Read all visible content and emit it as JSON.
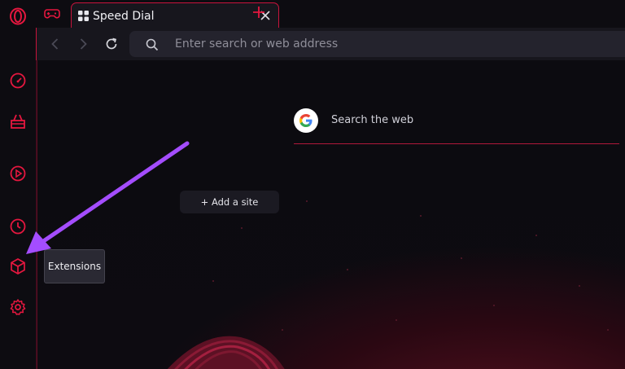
{
  "tab": {
    "title": "Speed Dial"
  },
  "address_bar": {
    "placeholder": "Enter search or web address"
  },
  "speed_dial": {
    "search_label": "Search the web",
    "add_site_label": "+ Add a site"
  },
  "tooltip": {
    "text": "Extensions"
  },
  "sidebar": {
    "items": [
      {
        "icon": "opera-logo-icon"
      },
      {
        "icon": "speedometer-icon"
      },
      {
        "icon": "shopping-basket-icon"
      },
      {
        "icon": "player-icon"
      },
      {
        "icon": "history-clock-icon"
      },
      {
        "icon": "extensions-cube-icon"
      },
      {
        "icon": "settings-gear-icon"
      }
    ]
  },
  "colors": {
    "accent": "#e5173f",
    "annotation_arrow": "#a44dff"
  }
}
